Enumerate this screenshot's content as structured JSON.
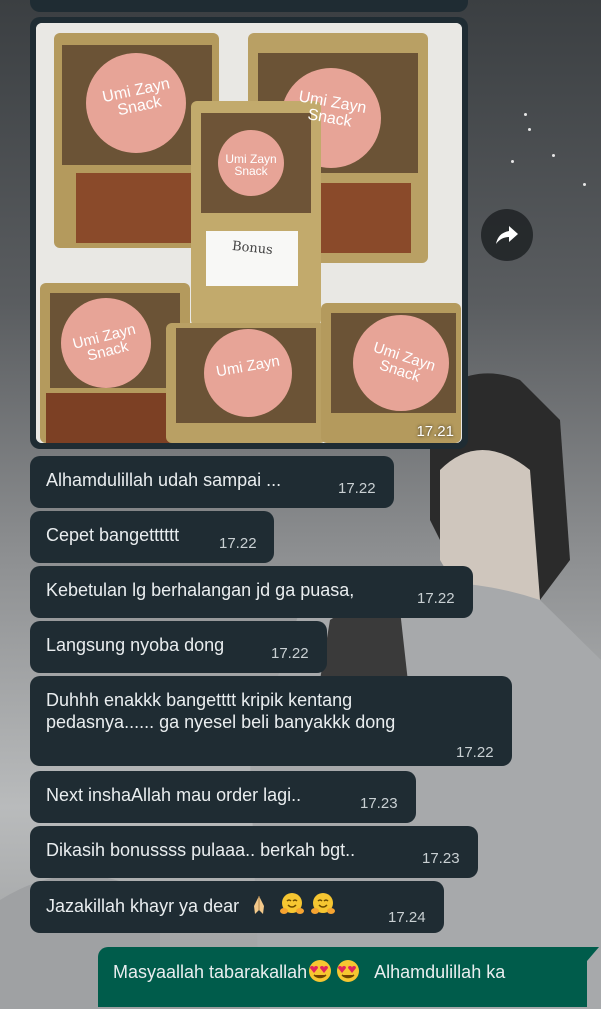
{
  "photo": {
    "time": "17.21",
    "package_brand_line1": "Umi Zayn",
    "package_brand_line2": "Snack",
    "bonus_label": "Bonus"
  },
  "forward_button": {
    "icon": "forward-icon"
  },
  "messages": [
    {
      "text": "Alhamdulillah udah sampai ...",
      "time": "17.22"
    },
    {
      "text": "Cepet bangetttttt",
      "time": "17.22"
    },
    {
      "text": "Kebetulan lg berhalangan jd ga puasa,",
      "time": "17.22"
    },
    {
      "text": "Langsung nyoba dong",
      "time": "17.22"
    },
    {
      "line1": "Duhhh enakkk bangetttt kripik kentang",
      "line2": "pedasnya...... ga nyesel beli banyakkk dong",
      "time": "17.22"
    },
    {
      "text": "Next inshaAllah mau order lagi..",
      "time": "17.23"
    },
    {
      "text": "Dikasih bonussss pulaaa.. berkah bgt..",
      "time": "17.23"
    },
    {
      "text": "Jazakillah khayr ya dear",
      "emojis": [
        "folded-hands-emoji",
        "hugging-face-emoji",
        "hugging-face-emoji"
      ],
      "time": "17.24"
    }
  ],
  "outgoing": {
    "text_part1": "Masyaallah tabarakallah",
    "emojis": [
      "heart-eyes-emoji",
      "heart-eyes-emoji"
    ],
    "text_part2": "Alhamdulillah ka"
  },
  "colors": {
    "incoming_bubble": "#1f2c33",
    "outgoing_bubble": "#005c4b",
    "text": "#e9edef"
  }
}
